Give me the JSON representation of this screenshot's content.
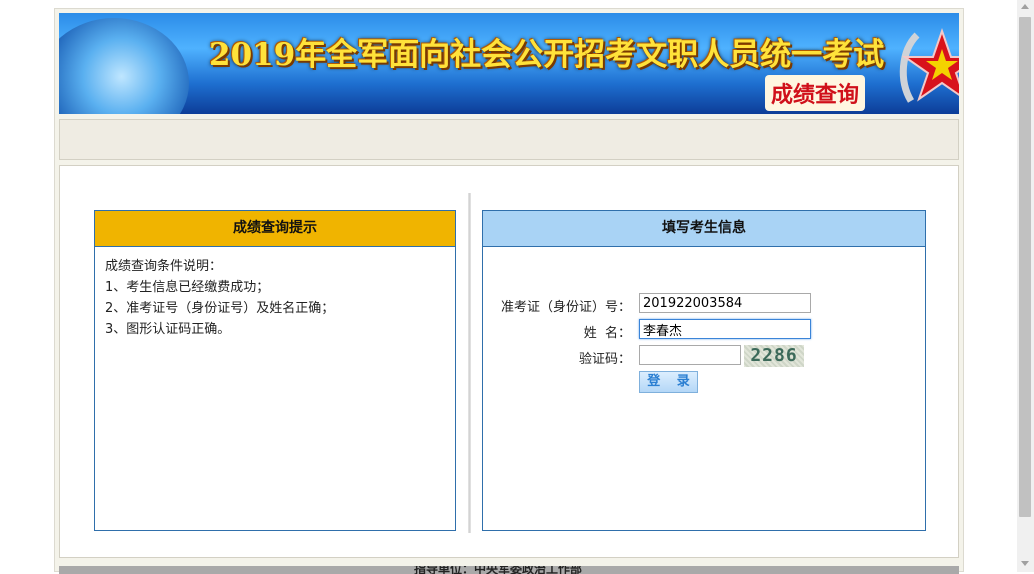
{
  "banner": {
    "title": "2019年全军面向社会公开招考文职人员统一考试",
    "subtitle": "成绩查询",
    "emblem": "army-star-emblem-icon"
  },
  "tips": {
    "heading": "成绩查询提示",
    "lines": [
      "成绩查询条件说明：",
      "1、考生信息已经缴费成功；",
      "2、准考证号（身份证号）及姓名正确；",
      "3、图形认证码正确。"
    ]
  },
  "form": {
    "heading": "填写考生信息",
    "id_label": "准考证（身份证）号：",
    "id_value": "201922003584",
    "name_label": "姓  名：",
    "name_value": "李春杰",
    "captcha_label": "验证码：",
    "captcha_value": "",
    "captcha_image_text": "2286",
    "login_label": "登 录"
  },
  "footer": {
    "text": "指导单位：中央军委政治工作部"
  },
  "colors": {
    "tips_header": "#f0b400",
    "form_header": "#a9d3f5",
    "panel_border": "#2f6fab",
    "button_text": "#2b7fd2"
  }
}
